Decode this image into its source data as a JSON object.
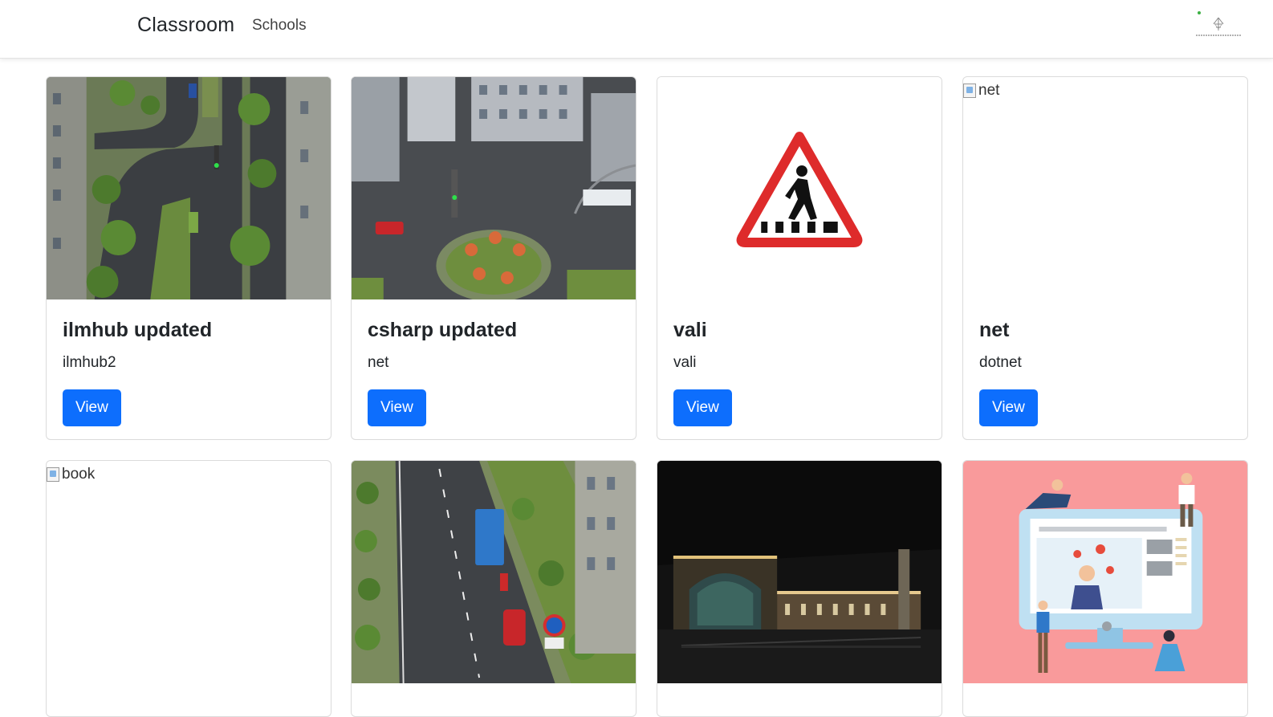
{
  "navbar": {
    "brand": "Classroom",
    "links": [
      "Schools"
    ],
    "logo_icon": "brand-logo-icon"
  },
  "cards": [
    {
      "title": "ilmhub updated",
      "text": "ilmhub2",
      "button": "View",
      "image": "city-intersection-image",
      "image_alt": ""
    },
    {
      "title": "csharp updated",
      "text": "net",
      "button": "View",
      "image": "roundabout-image",
      "image_alt": ""
    },
    {
      "title": "vali",
      "text": "vali",
      "button": "View",
      "image": "pedestrian-sign-image",
      "image_alt": ""
    },
    {
      "title": "net",
      "text": "dotnet",
      "button": "View",
      "image": "broken-image",
      "image_alt": "net"
    },
    {
      "title": "",
      "text": "",
      "button": "",
      "image": "broken-image",
      "image_alt": "book"
    },
    {
      "title": "",
      "text": "",
      "button": "",
      "image": "city-road-image",
      "image_alt": ""
    },
    {
      "title": "",
      "text": "",
      "button": "",
      "image": "night-building-image",
      "image_alt": ""
    },
    {
      "title": "",
      "text": "",
      "button": "",
      "image": "online-learning-illustration",
      "image_alt": ""
    }
  ],
  "colors": {
    "primary": "#0d6efd",
    "illustration_bg": "#f99a9b"
  }
}
